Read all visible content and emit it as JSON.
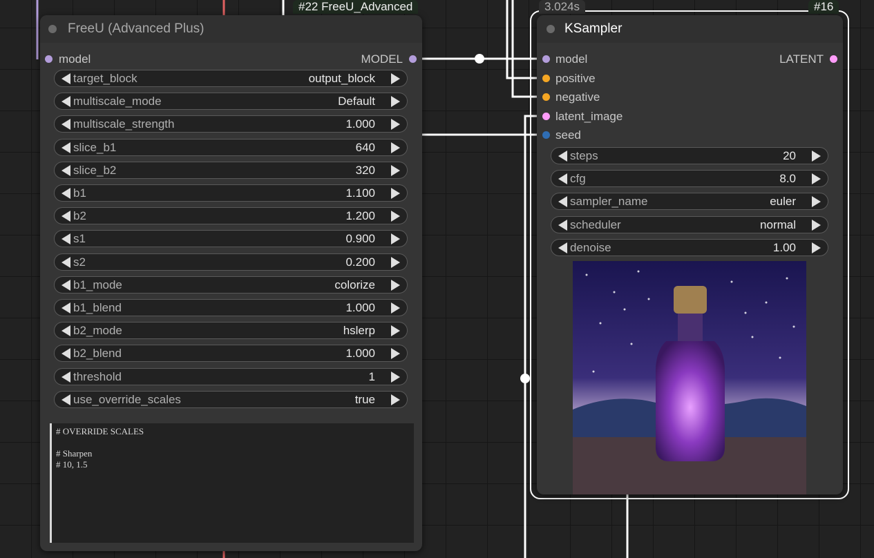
{
  "freeu_node": {
    "id_badge": "#22 FreeU_Advanced",
    "title": "FreeU (Advanced Plus)",
    "input_model": "model",
    "output_model": "MODEL",
    "widgets": [
      {
        "name": "target_block",
        "value": "output_block"
      },
      {
        "name": "multiscale_mode",
        "value": "Default"
      },
      {
        "name": "multiscale_strength",
        "value": "1.000"
      },
      {
        "name": "slice_b1",
        "value": "640"
      },
      {
        "name": "slice_b2",
        "value": "320"
      },
      {
        "name": "b1",
        "value": "1.100"
      },
      {
        "name": "b2",
        "value": "1.200"
      },
      {
        "name": "s1",
        "value": "0.900"
      },
      {
        "name": "s2",
        "value": "0.200"
      },
      {
        "name": "b1_mode",
        "value": "colorize"
      },
      {
        "name": "b1_blend",
        "value": "1.000"
      },
      {
        "name": "b2_mode",
        "value": "hslerp"
      },
      {
        "name": "b2_blend",
        "value": "1.000"
      },
      {
        "name": "threshold",
        "value": "1"
      },
      {
        "name": "use_override_scales",
        "value": "true"
      }
    ],
    "override_text": "# OVERRIDE SCALES\n\n# Sharpen\n# 10, 1.5"
  },
  "ksampler_node": {
    "time_badge": "3.024s",
    "id_badge": "#16",
    "title": "KSampler",
    "output_latent": "LATENT",
    "inputs": [
      {
        "name": "model",
        "color": "#b39ddb"
      },
      {
        "name": "positive",
        "color": "#f5a623"
      },
      {
        "name": "negative",
        "color": "#f5a623"
      },
      {
        "name": "latent_image",
        "color": "#ff9cf9"
      },
      {
        "name": "seed",
        "color": "#2f6db3"
      }
    ],
    "widgets": [
      {
        "name": "steps",
        "value": "20"
      },
      {
        "name": "cfg",
        "value": "8.0"
      },
      {
        "name": "sampler_name",
        "value": "euler"
      },
      {
        "name": "scheduler",
        "value": "normal"
      },
      {
        "name": "denoise",
        "value": "1.00"
      }
    ]
  },
  "colors": {
    "model_slot": "#b39ddb",
    "latent_slot": "#ff9cf9",
    "conditioning_slot": "#f5a623",
    "int_slot": "#2f6db3"
  }
}
